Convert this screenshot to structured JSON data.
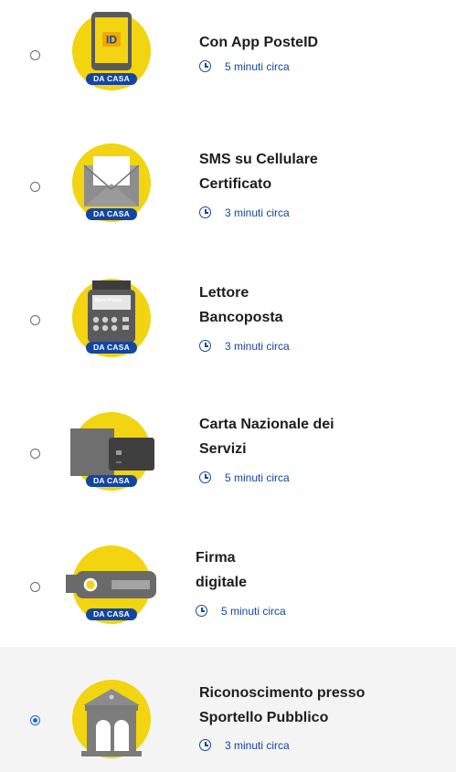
{
  "options": [
    {
      "title_lines": [
        "Con App PosteID"
      ],
      "duration": "5 minuti circa",
      "badge": "DA CASA",
      "icon": "phone-id-icon",
      "selected": false,
      "icon_text": "ID"
    },
    {
      "title_lines": [
        "SMS su Cellulare",
        "Certificato"
      ],
      "duration": "3 minuti circa",
      "badge": "DA CASA",
      "icon": "envelope-icon",
      "selected": false
    },
    {
      "title_lines": [
        "Lettore",
        "Bancoposta"
      ],
      "duration": "3 minuti circa",
      "badge": "DA CASA",
      "icon": "card-reader-icon",
      "selected": false,
      "icon_text": "BancoPosta"
    },
    {
      "title_lines": [
        "Carta Nazionale dei",
        "Servizi"
      ],
      "duration": "5 minuti circa",
      "badge": "DA CASA",
      "icon": "smart-card-icon",
      "selected": false
    },
    {
      "title_lines": [
        "Firma",
        "digitale"
      ],
      "duration": "5 minuti circa",
      "badge": "DA CASA",
      "icon": "usb-token-icon",
      "selected": false
    },
    {
      "title_lines": [
        "Riconoscimento presso",
        "Sportello Pubblico"
      ],
      "duration": "3 minuti circa",
      "icon": "bank-building-icon",
      "selected": true
    }
  ],
  "colors": {
    "accent_yellow": "#f2d410",
    "brand_blue": "#1446a0",
    "radio_selected": "#1a63d8"
  }
}
